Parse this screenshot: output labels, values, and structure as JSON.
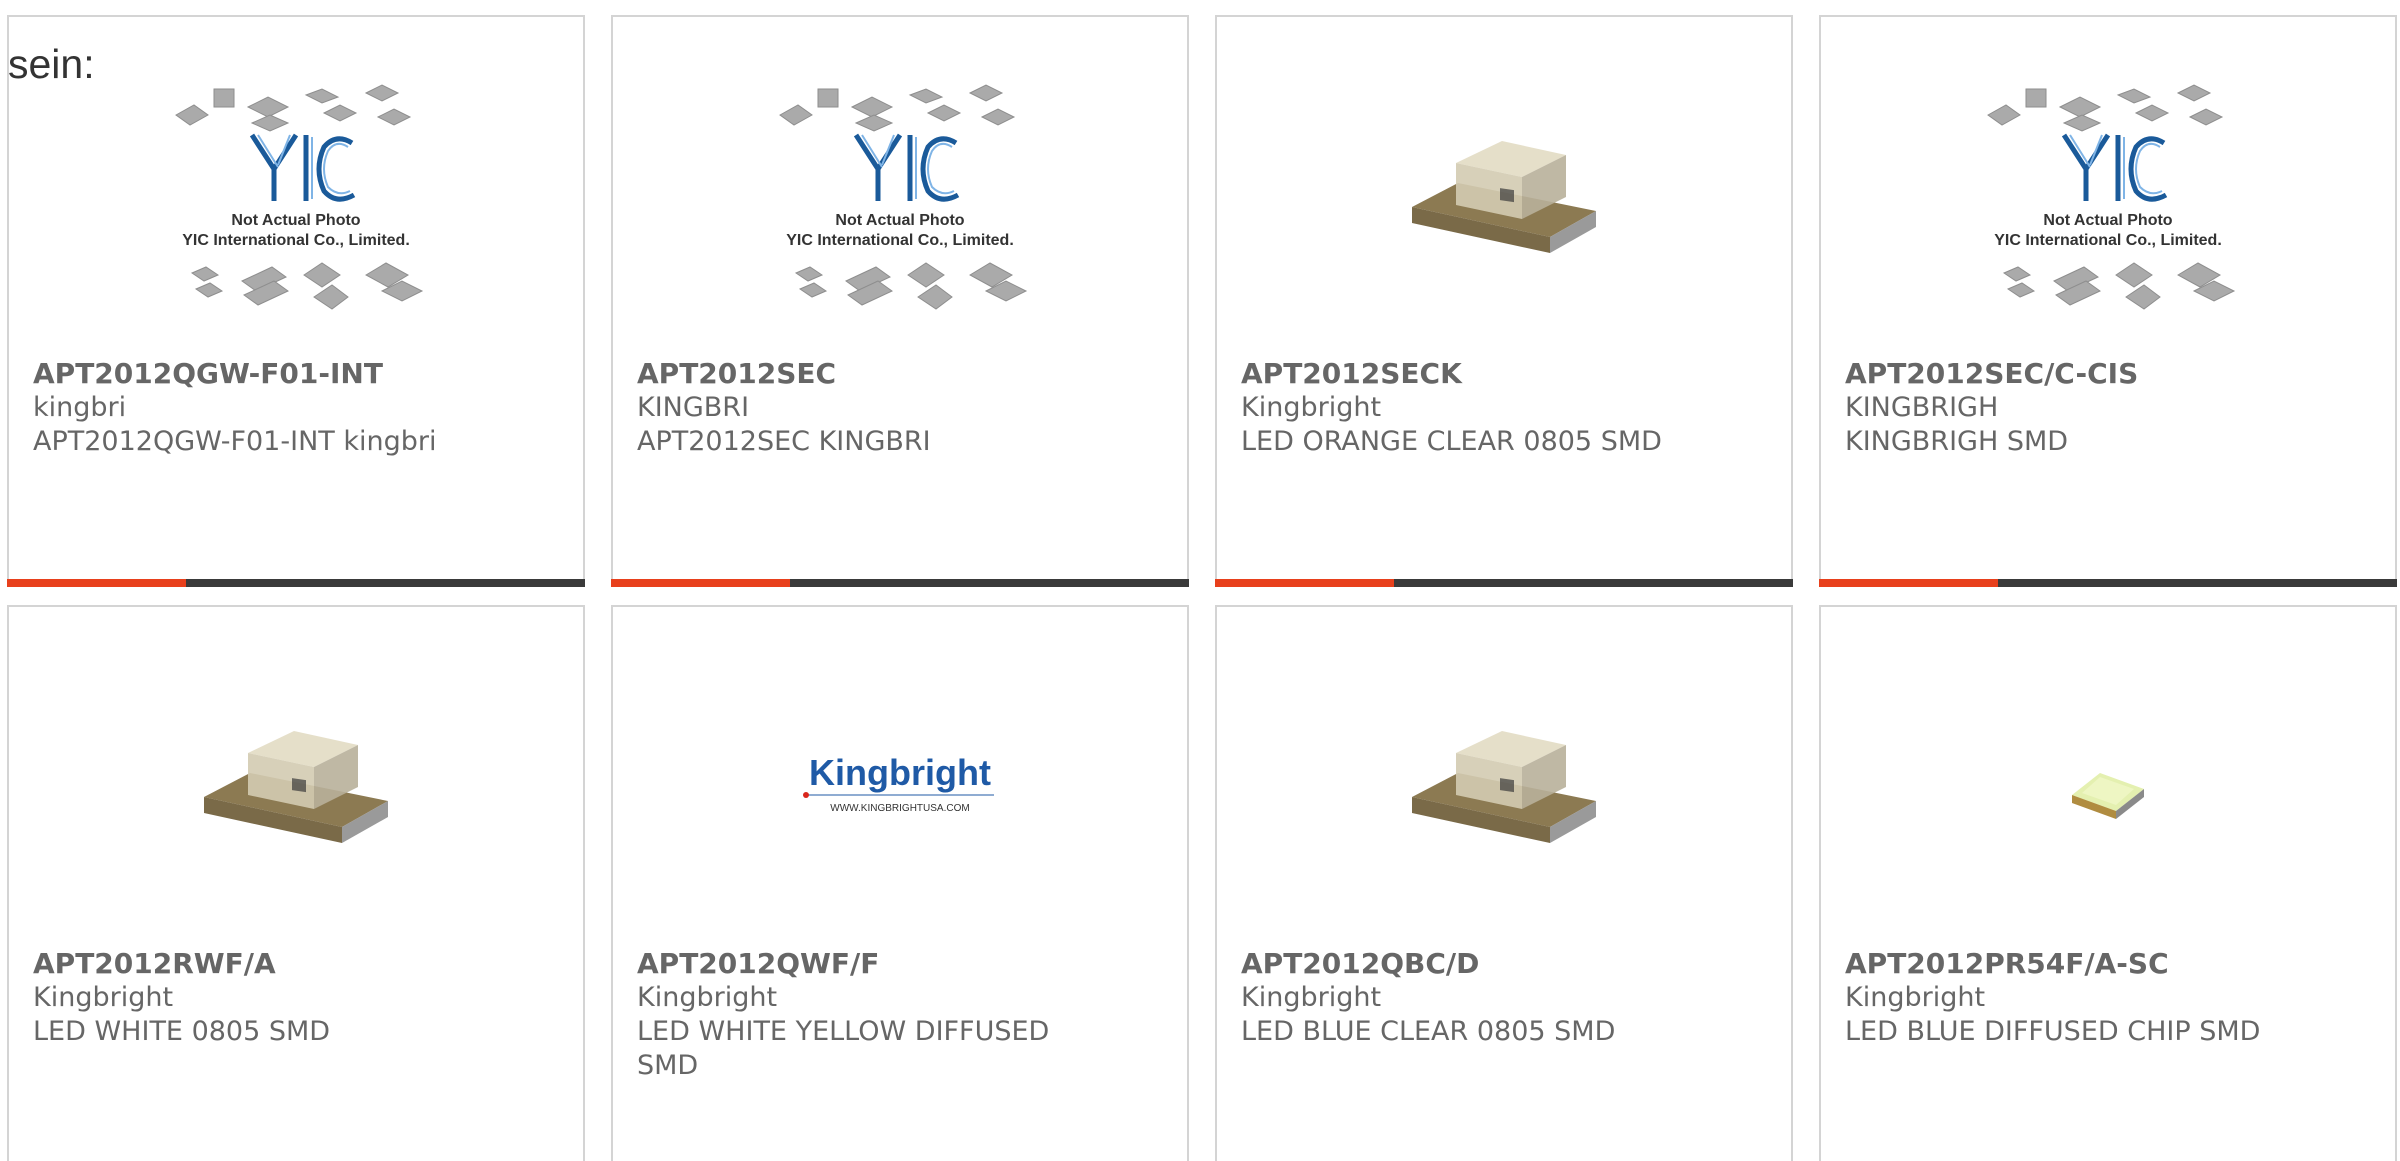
{
  "intro_text": "sein:",
  "colors": {
    "progress_accent": "#e8401c",
    "progress_track": "#3a3a3a",
    "card_border": "#d4d4d4",
    "text_gray": "#666666"
  },
  "cards": [
    {
      "part_number": "APT2012QGW-F01-INT",
      "manufacturer": "kingbri",
      "description": "APT2012QGW-F01-INT kingbri",
      "image": "yic-placeholder-image",
      "image_text_line1": "Not Actual Photo",
      "image_text_line2": "YIC International Co., Limited.",
      "image_logo": "YIC",
      "progress": 0.31
    },
    {
      "part_number": "APT2012SEC",
      "manufacturer": "KINGBRI",
      "description": "APT2012SEC KINGBRI",
      "image": "yic-placeholder-image",
      "image_text_line1": "Not Actual Photo",
      "image_text_line2": "YIC International Co., Limited.",
      "image_logo": "YIC",
      "progress": 0.31
    },
    {
      "part_number": "APT2012SECK",
      "manufacturer": "Kingbright",
      "description": "LED ORANGE CLEAR 0805 SMD",
      "image": "smd-led-clear-image",
      "progress": 0.31
    },
    {
      "part_number": "APT2012SEC/C-CIS",
      "manufacturer": "KINGBRIGH",
      "description": "KINGBRIGH SMD",
      "image": "yic-placeholder-image",
      "image_text_line1": "Not Actual Photo",
      "image_text_line2": "YIC International Co., Limited.",
      "image_logo": "YIC",
      "progress": 0.31
    },
    {
      "part_number": "APT2012RWF/A",
      "manufacturer": "Kingbright",
      "description": "LED WHITE 0805 SMD",
      "image": "smd-led-clear-image"
    },
    {
      "part_number": "APT2012QWF/F",
      "manufacturer": "Kingbright",
      "description": "LED WHITE YELLOW DIFFUSED SMD",
      "image": "kingbright-logo-image",
      "image_logo": "Kingbright",
      "image_url_text": "WWW.KINGBRIGHTUSA.COM"
    },
    {
      "part_number": "APT2012QBC/D",
      "manufacturer": "Kingbright",
      "description": "LED BLUE CLEAR 0805 SMD",
      "image": "smd-led-clear-image"
    },
    {
      "part_number": "APT2012PR54F/A-SC",
      "manufacturer": "Kingbright",
      "description": "LED BLUE DIFFUSED CHIP SMD",
      "image": "smd-led-diffused-image"
    }
  ]
}
